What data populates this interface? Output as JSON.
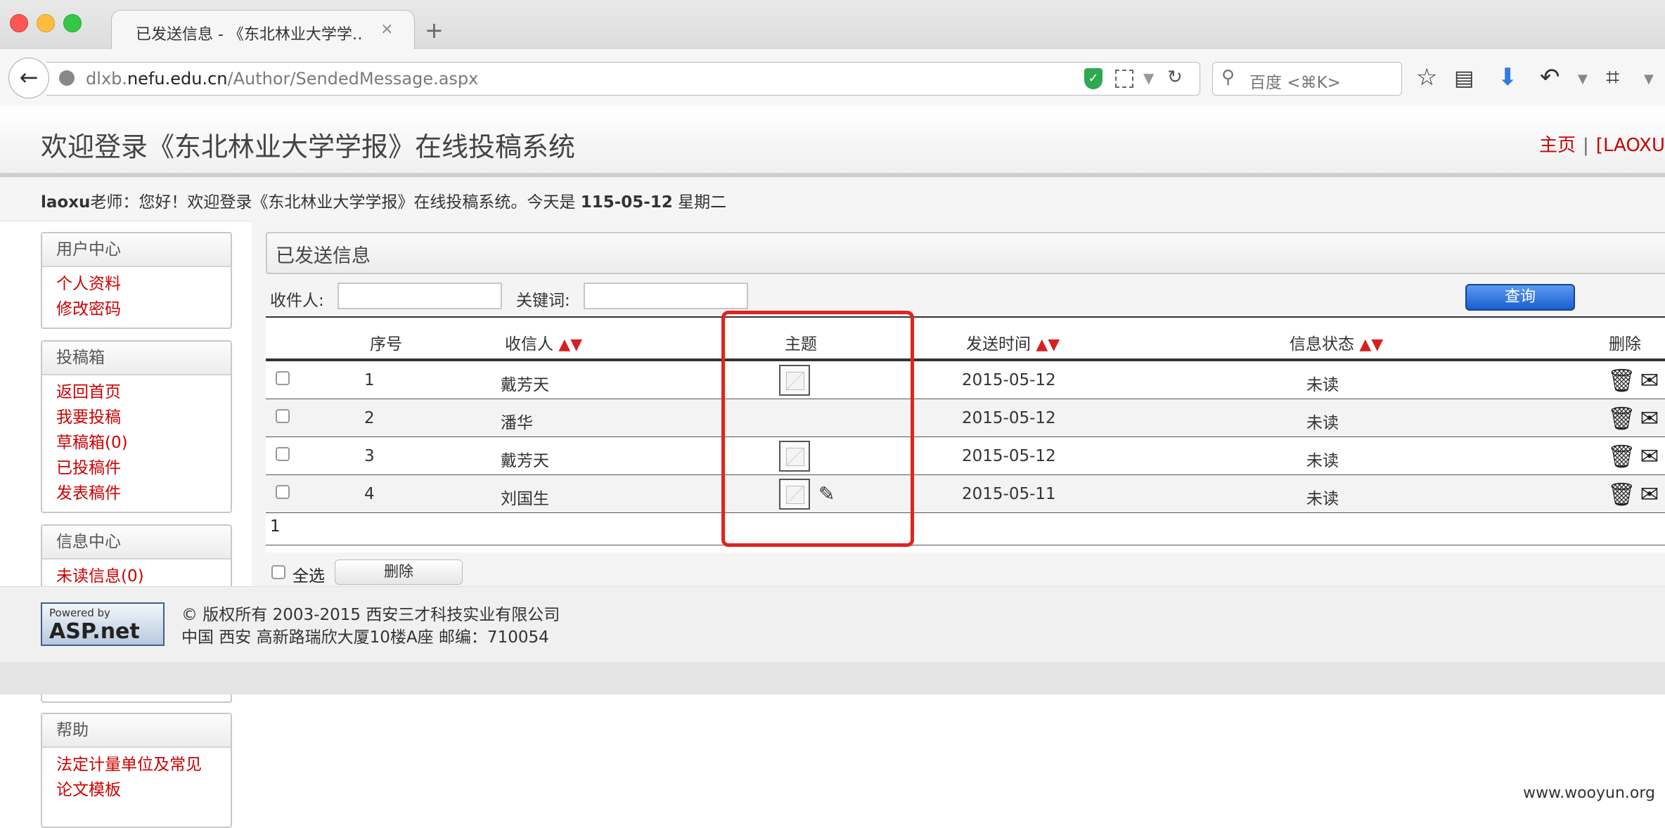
{
  "browser": {
    "tab_title": "已发送信息 - 《东北林业大学学…",
    "tab_close": "×",
    "new_tab": "+",
    "url_prefix": "dlxb.",
    "url_domain": "nefu.edu.cn",
    "url_path": "/Author/SendedMessage.aspx",
    "search_placeholder": "百度 <⌘K>"
  },
  "header": {
    "site_title": "欢迎登录《东北林业大学学报》在线投稿系统",
    "home_link": "主页",
    "separator": "|",
    "user_link": "[LAOXU"
  },
  "welcome": {
    "user": "laoxu",
    "text1": "老师：您好！欢迎登录《东北林业大学学报》在线投稿系统。今天是 ",
    "date": "115-05-12",
    "text2": " 星期二"
  },
  "sidebar": {
    "user_center": {
      "title": "用户中心",
      "items": [
        "个人资料",
        "修改密码"
      ]
    },
    "submission_box": {
      "title": "投稿箱",
      "items": [
        "返回首页",
        "我要投稿",
        "草稿箱(0)",
        "已投稿件",
        "发表稿件"
      ]
    },
    "message_center": {
      "title": "信息中心",
      "items": [
        "未读信息(0)"
      ]
    },
    "help": {
      "title": "帮助",
      "items": [
        "法定计量单位及常见",
        "论文模板"
      ]
    }
  },
  "main": {
    "panel_title": "已发送信息",
    "recipient_label": "收件人:",
    "keyword_label": "关键词:",
    "query_button": "查询",
    "columns": {
      "seq": "序号",
      "recipient": "收信人",
      "subject": "主题",
      "send_time": "发送时间",
      "status": "信息状态",
      "delete": "删除"
    },
    "sort_arrows": "▲▼",
    "rows": [
      {
        "seq": "1",
        "recipient": "戴芳天",
        "date": "2015-05-12",
        "status": "未读"
      },
      {
        "seq": "2",
        "recipient": "潘华",
        "date": "2015-05-12",
        "status": "未读"
      },
      {
        "seq": "3",
        "recipient": "戴芳天",
        "date": "2015-05-12",
        "status": "未读"
      },
      {
        "seq": "4",
        "recipient": "刘国生",
        "date": "2015-05-11",
        "status": "未读"
      }
    ],
    "page_number": "1",
    "select_all": "全选",
    "delete_button": "删除",
    "row_action_icons": "🗑✉"
  },
  "footer": {
    "powered_by": "Powered by",
    "asp_net": "ASP.net",
    "copyright": "© 版权所有 2003-2015 西安三才科技实业有限公司",
    "address": "中国 西安 高新路瑞欣大厦10楼A座 邮编：710054"
  },
  "watermark": "www.wooyun.org",
  "colors": {
    "link_red": "#cc0000",
    "highlight_red": "#e0241e",
    "button_blue": "#1a5fcf"
  }
}
